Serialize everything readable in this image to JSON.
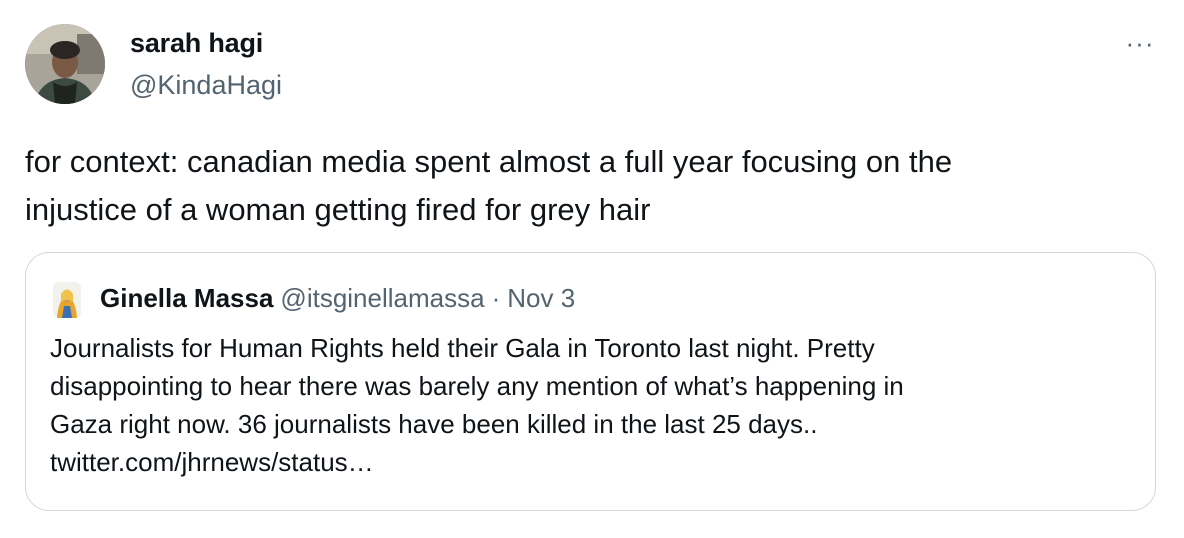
{
  "tweet": {
    "author": {
      "display_name": "sarah hagi",
      "handle": "@KindaHagi"
    },
    "more_label": "···",
    "text_lines": [
      "for context: canadian media spent almost a full year focusing on the",
      "injustice of a woman getting fired for grey hair"
    ]
  },
  "quote": {
    "author": {
      "display_name": "Ginella Massa",
      "handle": "@itsginellamassa"
    },
    "separator": "·",
    "date": "Nov 3",
    "text_lines": [
      "Journalists for Human Rights held their Gala in Toronto last night. Pretty",
      "disappointing to hear there was barely any mention of what’s happening in",
      "Gaza right now. 36 journalists have been killed in the last 25 days..",
      "twitter.com/jhrnews/status…"
    ]
  },
  "colors": {
    "text_primary": "#0f1419",
    "text_secondary": "#536471",
    "border": "#cfd9de"
  }
}
